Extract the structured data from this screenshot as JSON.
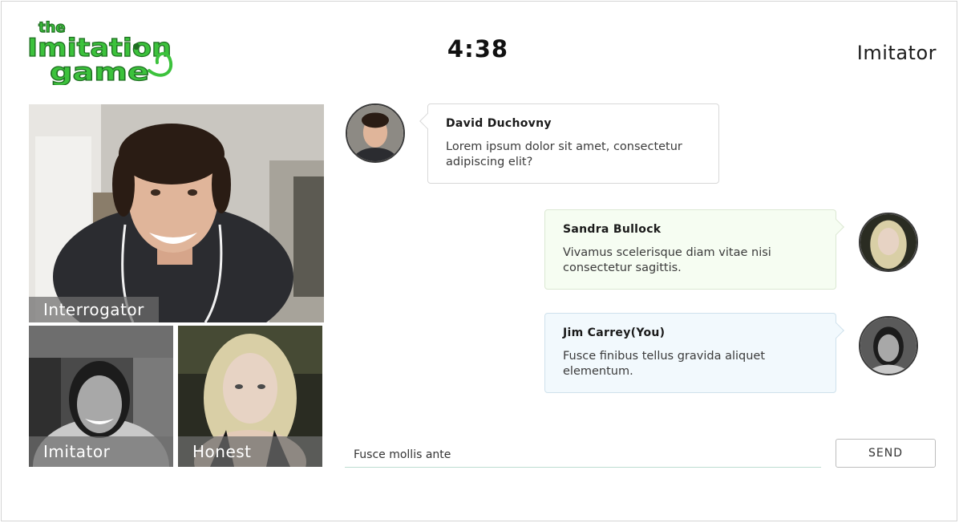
{
  "header": {
    "logo_words": [
      "the",
      "Imitation",
      "game"
    ],
    "timer": "4:38",
    "role": "Imitator"
  },
  "videos": [
    {
      "label": "Interrogator"
    },
    {
      "label": "Imitator"
    },
    {
      "label": "Honest"
    }
  ],
  "messages": [
    {
      "sender": "David Duchovny",
      "text": "Lorem ipsum dolor sit amet, consectetur adipiscing elit?",
      "side": "left"
    },
    {
      "sender": "Sandra Bullock",
      "text": "Vivamus scelerisque diam vitae nisi consectetur sagittis.",
      "side": "right"
    },
    {
      "sender": "Jim Carrey(You)",
      "text": "Fusce finibus tellus gravida aliquet elementum.",
      "side": "right"
    }
  ],
  "composer": {
    "value": "Fusce mollis ante",
    "send_label": "SEND"
  },
  "colors": {
    "logo_green": "#3cc23c",
    "logo_dark": "#1f6e22",
    "bubble_green": "#f6fdf2",
    "bubble_blue": "#f2f9fd"
  }
}
